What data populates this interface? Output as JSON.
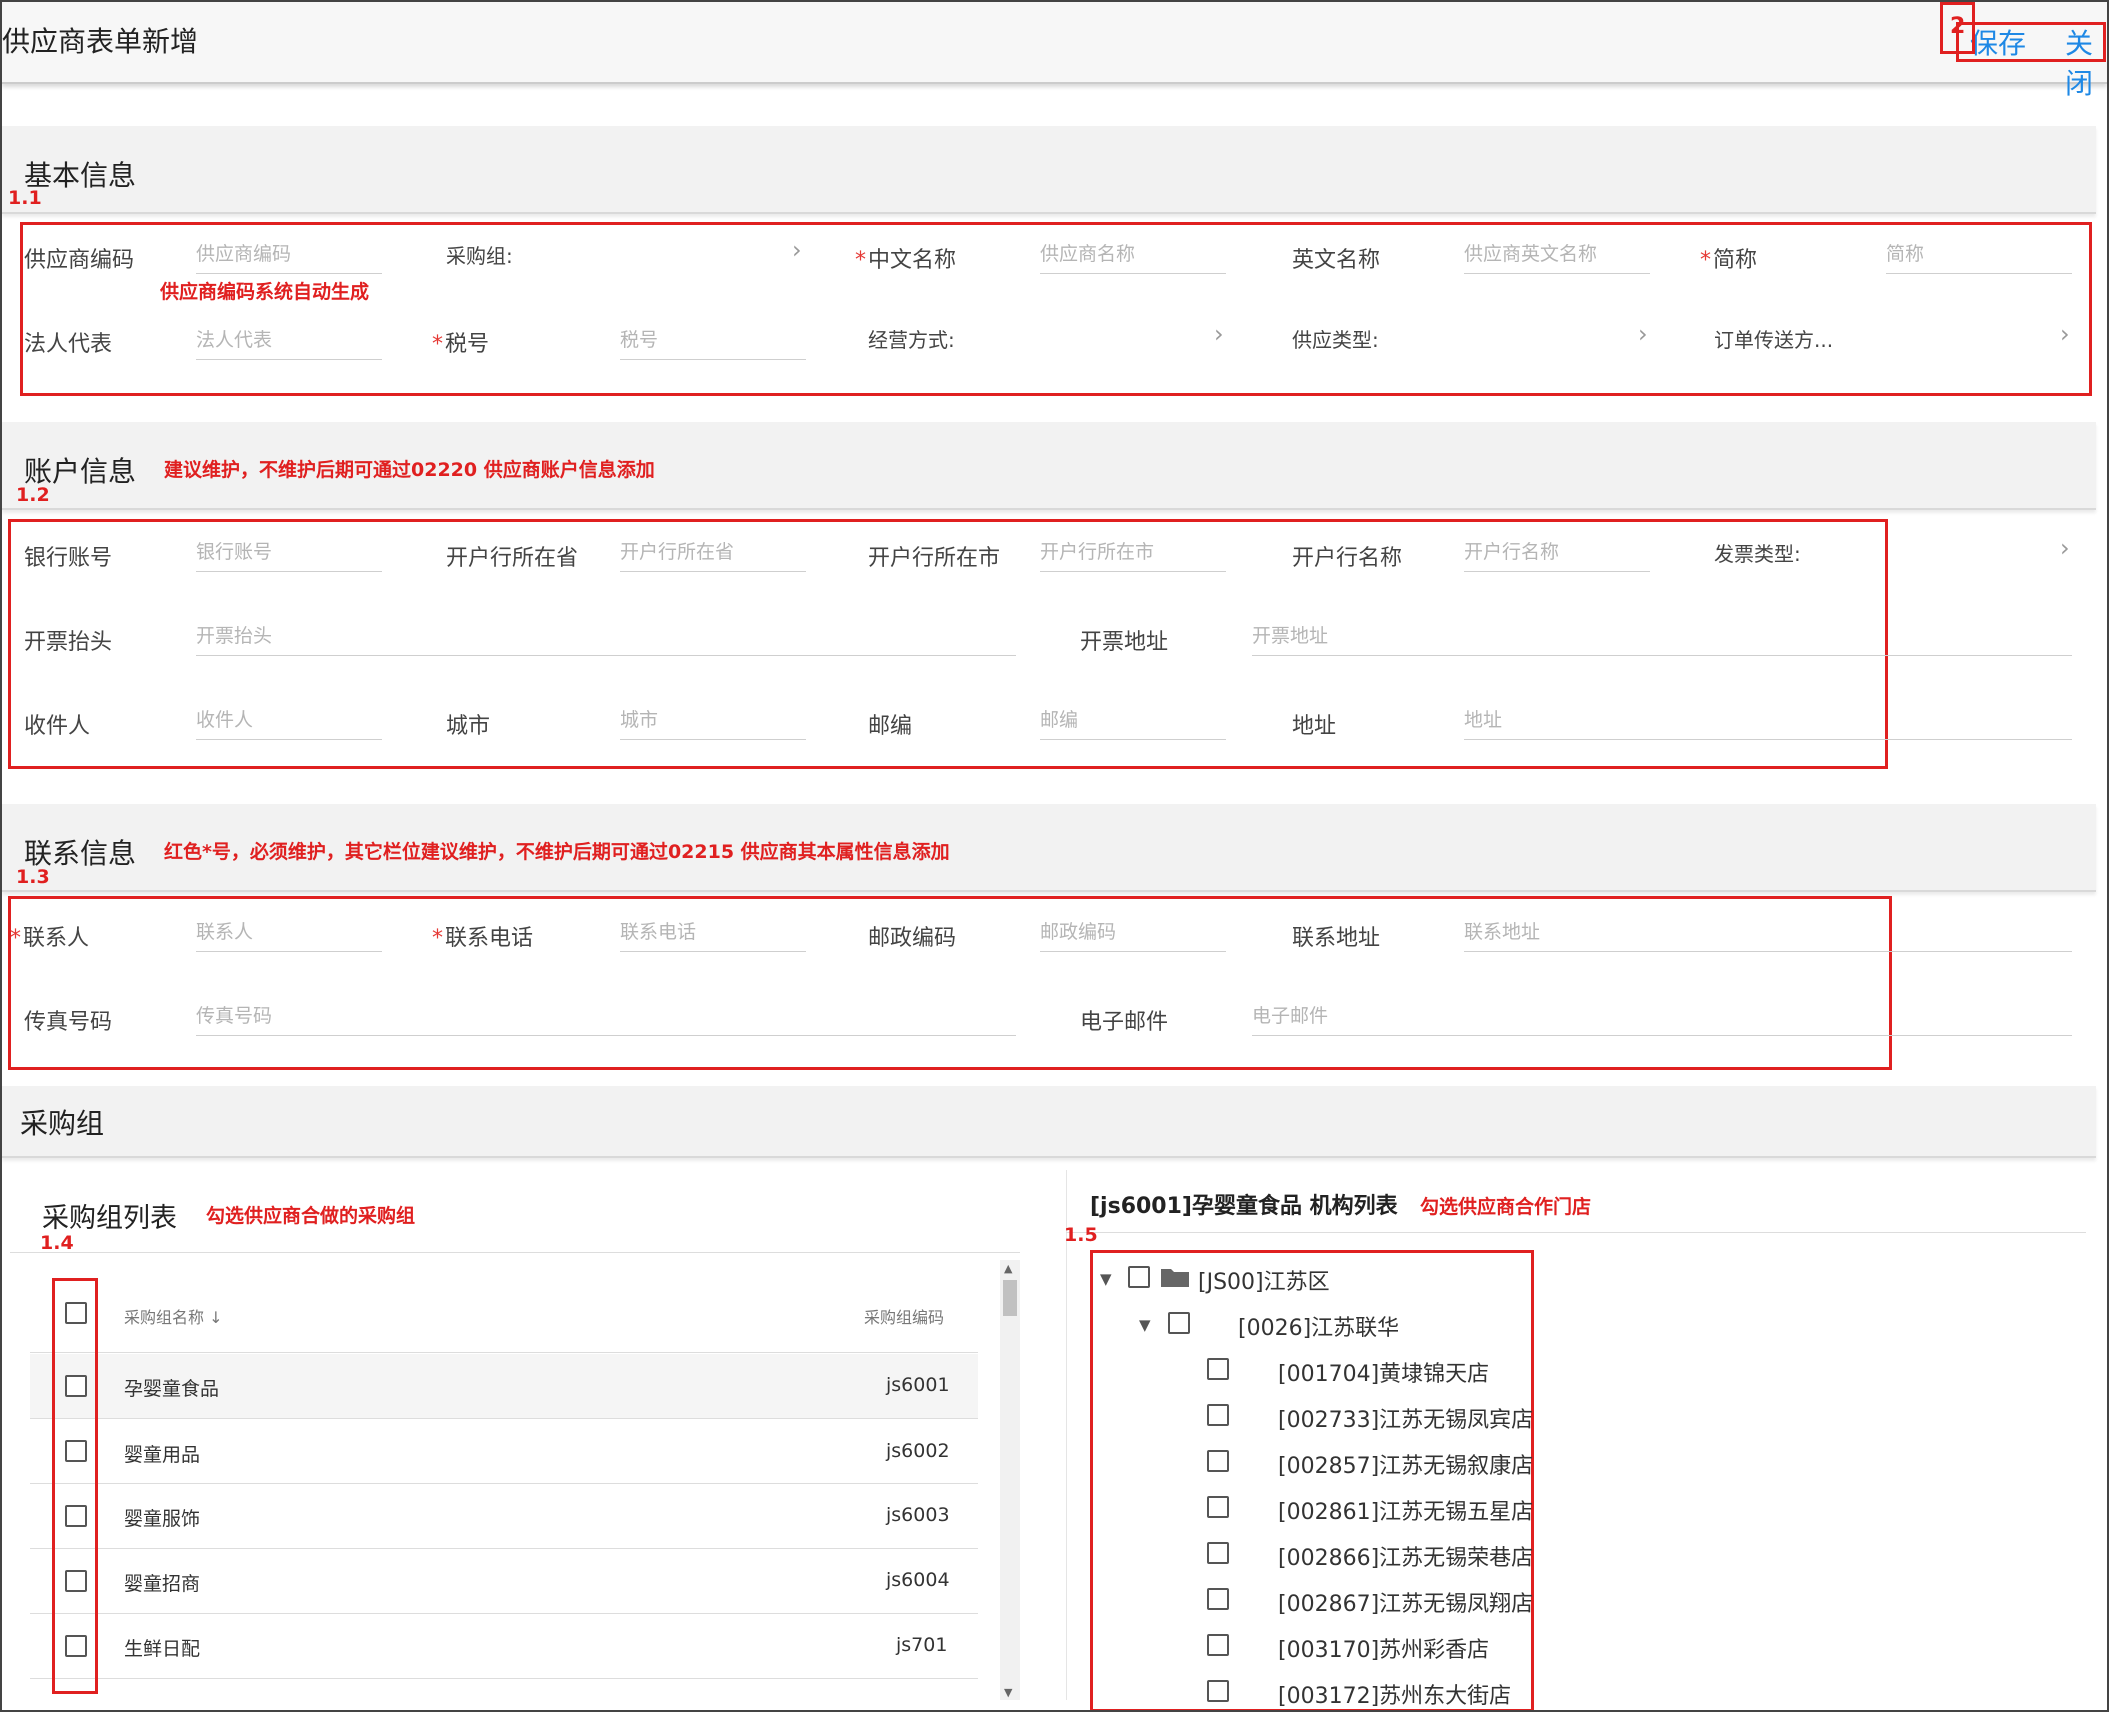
{
  "header": {
    "title": "供应商表单新增",
    "save_label": "保存",
    "close_label": "关闭"
  },
  "sections": {
    "basic": "基本信息",
    "account": "账户信息",
    "contact": "联系信息",
    "purchase": "采购组"
  },
  "basic": {
    "supplier_code_label": "供应商编码",
    "supplier_code_placeholder": "供应商编码",
    "purchase_group_label": "采购组:",
    "cn_name_label": "中文名称",
    "cn_name_placeholder": "供应商名称",
    "en_name_label": "英文名称",
    "en_name_placeholder": "供应商英文名称",
    "short_name_label": "简称",
    "short_name_placeholder": "简称",
    "legal_rep_label": "法人代表",
    "legal_rep_placeholder": "法人代表",
    "tax_no_label": "税号",
    "tax_no_placeholder": "税号",
    "business_mode_label": "经营方式:",
    "supply_type_label": "供应类型:",
    "order_send_label": "订单传送方..."
  },
  "account": {
    "bank_account_label": "银行账号",
    "bank_account_placeholder": "银行账号",
    "bank_province_label": "开户行所在省",
    "bank_province_placeholder": "开户行所在省",
    "bank_city_label": "开户行所在市",
    "bank_city_placeholder": "开户行所在市",
    "bank_name_label": "开户行名称",
    "bank_name_placeholder": "开户行名称",
    "invoice_type_label": "发票类型:",
    "invoice_title_label": "开票抬头",
    "invoice_title_placeholder": "开票抬头",
    "invoice_address_label": "开票地址",
    "invoice_address_placeholder": "开票地址",
    "recipient_label": "收件人",
    "recipient_placeholder": "收件人",
    "city_label": "城市",
    "city_placeholder": "城市",
    "postcode_label": "邮编",
    "postcode_placeholder": "邮编",
    "address_label": "地址",
    "address_placeholder": "地址"
  },
  "contact": {
    "contact_person_label": "联系人",
    "contact_person_placeholder": "联系人",
    "contact_phone_label": "联系电话",
    "contact_phone_placeholder": "联系电话",
    "postal_code_label": "邮政编码",
    "postal_code_placeholder": "邮政编码",
    "contact_address_label": "联系地址",
    "contact_address_placeholder": "联系地址",
    "fax_label": "传真号码",
    "fax_placeholder": "传真号码",
    "email_label": "电子邮件",
    "email_placeholder": "电子邮件"
  },
  "purchase_list": {
    "title": "采购组列表",
    "col_name": "采购组名称",
    "col_code": "采购组编码",
    "rows": [
      {
        "name": "孕婴童食品",
        "code": "js6001"
      },
      {
        "name": "婴童用品",
        "code": "js6002"
      },
      {
        "name": "婴童服饰",
        "code": "js6003"
      },
      {
        "name": "婴童招商",
        "code": "js6004"
      },
      {
        "name": "生鲜日配",
        "code": "js701"
      }
    ]
  },
  "org_tree": {
    "title": "[js6001]孕婴童食品 机构列表",
    "root": "[JS00]江苏区",
    "child": "[0026]江苏联华",
    "stores": [
      "[001704]黄埭锦天店",
      "[002733]江苏无锡凤宾店",
      "[002857]江苏无锡叙康店",
      "[002861]江苏无锡五星店",
      "[002866]江苏无锡荣巷店",
      "[002867]江苏无锡凤翔店",
      "[003170]苏州彩香店",
      "[003172]苏州东大街店"
    ]
  },
  "annotations": {
    "num_2": "2",
    "num_1_1": "1.1",
    "num_1_2": "1.2",
    "num_1_3": "1.3",
    "num_1_4": "1.4",
    "num_1_5": "1.5",
    "code_auto": "供应商编码系统自动生成",
    "account_note": "建议维护，不维护后期可通过02220 供应商账户信息添加",
    "contact_note": "红色*号，必须维护，其它栏位建议维护，不维护后期可通过02215 供应商其本属性信息添加",
    "purchase_note": "勾选供应商合做的采购组",
    "store_note": "勾选供应商合作门店"
  },
  "colors": {
    "accent": "#1e88e5",
    "annotation": "#e02020",
    "required": "#e53935"
  }
}
